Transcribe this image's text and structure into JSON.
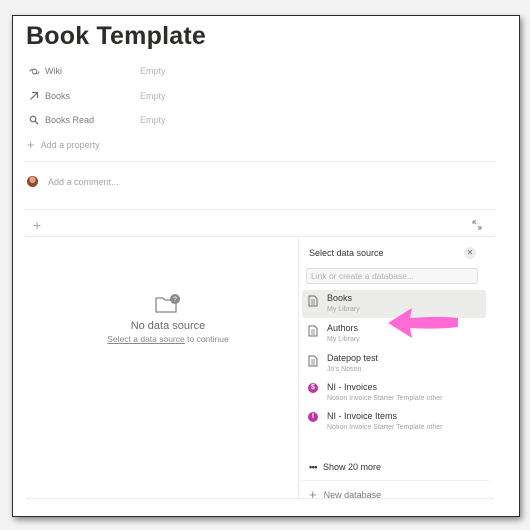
{
  "page": {
    "title": "Book Template"
  },
  "properties": [
    {
      "name": "Wiki",
      "value": "Empty",
      "icon": "relation-icon"
    },
    {
      "name": "Books",
      "value": "Empty",
      "icon": "arrow-up-right-icon"
    },
    {
      "name": "Books Read",
      "value": "Empty",
      "icon": "search-icon"
    }
  ],
  "add_property_label": "Add a property",
  "comment_placeholder": "Add a comment...",
  "empty_state": {
    "title": "No data source",
    "link_text": "Select a data source",
    "suffix": " to continue"
  },
  "panel": {
    "title": "Select data source",
    "search_placeholder": "Link or create a database...",
    "items": [
      {
        "name": "Books",
        "sub": "My Library",
        "icon": "page-icon",
        "selected": true
      },
      {
        "name": "Authors",
        "sub": "My Library",
        "icon": "page-icon",
        "selected": false
      },
      {
        "name": "Datepop test",
        "sub": "Jo's Notion",
        "icon": "page-icon",
        "selected": false
      },
      {
        "name": "NI - Invoices",
        "sub": "Notion Invoice Starter Template other",
        "icon": "dollar-icon",
        "selected": false
      },
      {
        "name": "NI - Invoice Items",
        "sub": "Notion Invoice Starter Template other",
        "icon": "item-icon",
        "selected": false
      }
    ],
    "show_more": "Show 20 more",
    "new_database": "New database"
  },
  "colors": {
    "annotation_arrow": "#ff6ad5",
    "invoice_badge": "#c035a0"
  }
}
